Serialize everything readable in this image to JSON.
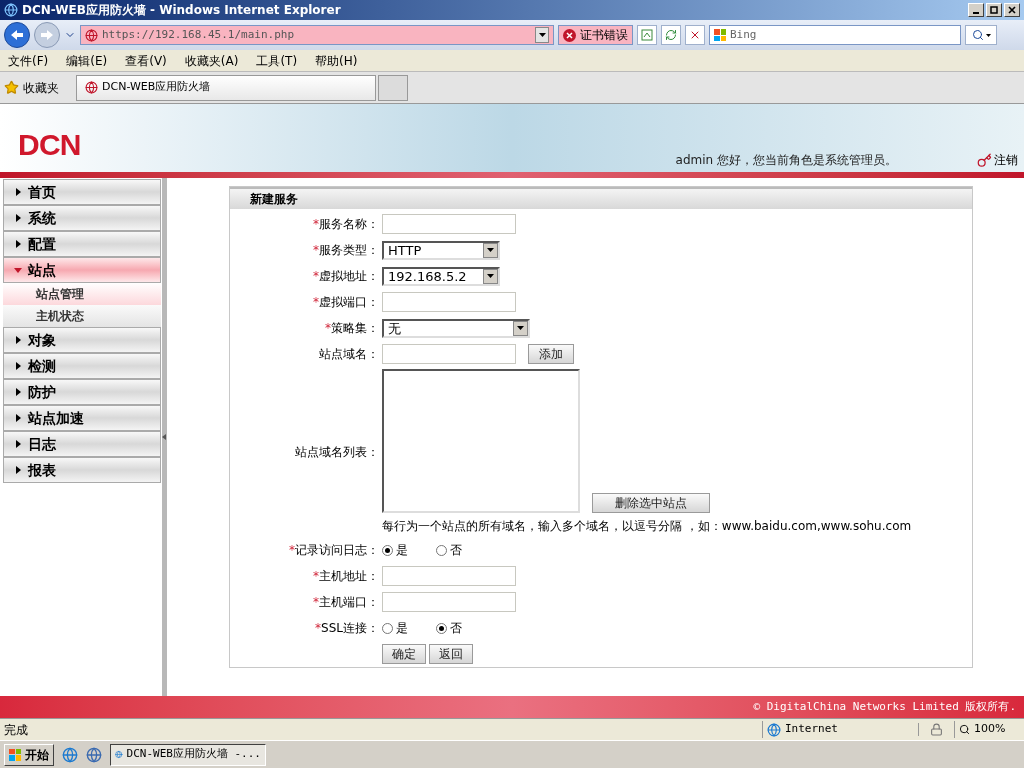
{
  "browser": {
    "title": "DCN-WEB应用防火墙 - Windows Internet Explorer",
    "address": "https://192.168.45.1/main.php",
    "cert_error": "证书错误",
    "search_placeholder": "Bing",
    "menu": [
      "文件(F)",
      "编辑(E)",
      "查看(V)",
      "收藏夹(A)",
      "工具(T)",
      "帮助(H)"
    ],
    "favorites": "收藏夹",
    "tab": "DCN-WEB应用防火墙"
  },
  "header": {
    "logo": "DCN",
    "user_text": "admin 您好，您当前角色是系统管理员。",
    "logout": "注销"
  },
  "sidebar": {
    "items": [
      {
        "label": "首页",
        "expanded": false
      },
      {
        "label": "系统",
        "expanded": false
      },
      {
        "label": "配置",
        "expanded": false
      },
      {
        "label": "站点",
        "expanded": true,
        "children": [
          {
            "label": "站点管理",
            "selected": true
          },
          {
            "label": "主机状态",
            "selected": false
          }
        ]
      },
      {
        "label": "对象",
        "expanded": false
      },
      {
        "label": "检测",
        "expanded": false
      },
      {
        "label": "防护",
        "expanded": false
      },
      {
        "label": "站点加速",
        "expanded": false
      },
      {
        "label": "日志",
        "expanded": false
      },
      {
        "label": "报表",
        "expanded": false
      }
    ]
  },
  "form": {
    "title": "新建服务",
    "required_mark": "*",
    "rows": [
      {
        "kind": "text",
        "label": "服务名称：",
        "required": true
      },
      {
        "kind": "select",
        "label": "服务类型：",
        "required": true,
        "value": "HTTP"
      },
      {
        "kind": "select",
        "label": "虚拟地址：",
        "required": true,
        "value": "192.168.5.2"
      },
      {
        "kind": "text",
        "label": "虚拟端口：",
        "required": true
      },
      {
        "kind": "wide_select",
        "label": "策略集：",
        "required": true,
        "value": "无"
      },
      {
        "kind": "text",
        "label": "站点域名：",
        "required": false,
        "button": "添加"
      },
      {
        "kind": "textarea",
        "label": "站点域名列表：",
        "required": false,
        "button": "删除选中站点",
        "note": "每行为一个站点的所有域名，输入多个域名，以逗号分隔 ，如：www.baidu.com,www.sohu.com"
      },
      {
        "kind": "radio",
        "label": "记录访问日志：",
        "required": true,
        "options": [
          {
            "label": "是",
            "selected": true
          },
          {
            "label": "否",
            "selected": false
          }
        ]
      },
      {
        "kind": "text",
        "label": "主机地址：",
        "required": true
      },
      {
        "kind": "text",
        "label": "主机端口：",
        "required": true
      },
      {
        "kind": "radio",
        "label": "SSL连接：",
        "required": true,
        "options": [
          {
            "label": "是",
            "selected": false
          },
          {
            "label": "否",
            "selected": true
          }
        ]
      },
      {
        "kind": "buttons",
        "buttons": [
          "确定",
          "返回"
        ]
      }
    ]
  },
  "footer": "© DigitalChina Networks Limited 版权所有.",
  "status_bar": {
    "text": "完成",
    "zone": "Internet",
    "zoom": "100%"
  },
  "taskbar": {
    "start": "开始",
    "task": "DCN-WEB应用防火墙 -..."
  }
}
